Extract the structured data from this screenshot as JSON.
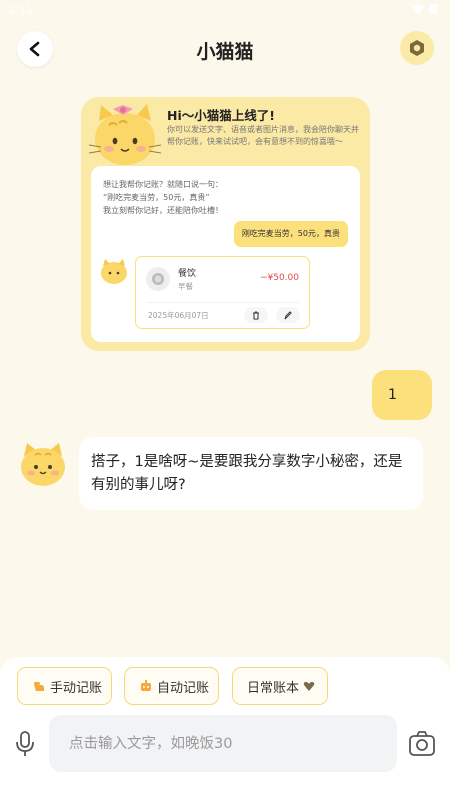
{
  "status": {
    "time": "2:11"
  },
  "header": {
    "title": "小猫猫"
  },
  "intro": {
    "title": "Hi～小猫猫上线了!",
    "desc": "你可以发送文字、语音或者图片消息，我会陪你聊天并帮你记账，快来试试吧，会有意想不到的惊喜哦～",
    "tip_line1": "想让我帮你记账？就随口说一句：",
    "tip_line2": "“刚吃完麦当劳，50元，真贵”",
    "tip_line3": "我立刻帮你记好，还能陪你吐槽！",
    "example_msg": "刚吃完麦当劳，50元，真贵",
    "record": {
      "category": "餐饮",
      "subcategory": "早餐",
      "amount": "−¥50.00",
      "date": "2025年06月07日"
    }
  },
  "messages": {
    "user_text": "1",
    "bot_text": "搭子，1是啥呀~是要跟我分享数字小秘密，还是有别的事儿呀?"
  },
  "chips": {
    "manual": "手动记账",
    "auto": "自动记账",
    "book": "日常账本"
  },
  "input": {
    "placeholder": "点击输入文字，如晚饭30"
  },
  "colors": {
    "accent": "#fbe07b",
    "card": "#fbe9a6",
    "background": "#fdf8ec",
    "amount": "#e5484d"
  }
}
